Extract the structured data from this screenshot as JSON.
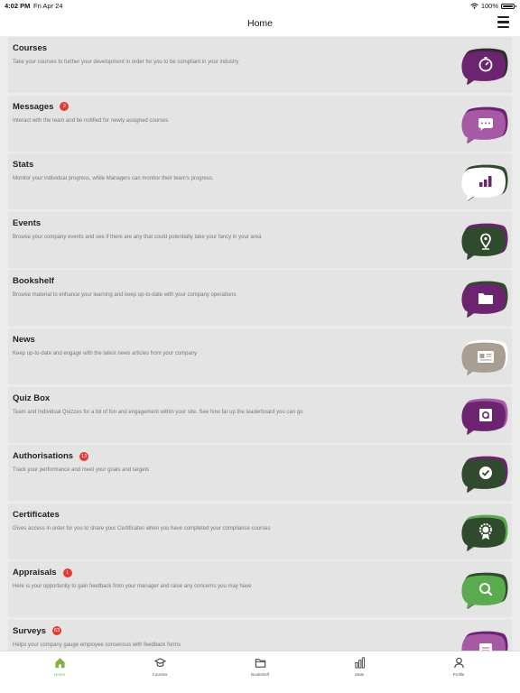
{
  "status": {
    "time": "4:02 PM",
    "date": "Fri Apr 24",
    "battery": "100%"
  },
  "header": {
    "title": "Home"
  },
  "items": [
    {
      "title": "Courses",
      "badge": "",
      "desc": "Take your courses to further your development in order for you to be compliant in your industry",
      "icon": "stopwatch-icon",
      "bubble": "#6d2470",
      "shadow": "#2e2e2e",
      "icon_color": "#ffffff"
    },
    {
      "title": "Messages",
      "badge": "2",
      "desc": "Interact with the team and be notified for newly assigned courses",
      "icon": "chat-icon",
      "bubble": "#a65aa6",
      "shadow": "#6d2470",
      "icon_color": "#ffffff"
    },
    {
      "title": "Stats",
      "badge": "",
      "desc": "Monitor your individual progress, while Managers can monitor their team's progress.",
      "icon": "bar-chart-icon",
      "bubble": "#ffffff",
      "shadow": "#2f4a2c",
      "icon_color": "#6d2470"
    },
    {
      "title": "Events",
      "badge": "",
      "desc": "Browse your company events and see if there are any that could potentially take your fancy in your area",
      "icon": "location-pin-icon",
      "bubble": "#2f4a2c",
      "shadow": "#6d2470",
      "icon_color": "#ffffff"
    },
    {
      "title": "Bookshelf",
      "badge": "",
      "desc": "Browse material to enhance your learning and keep up-to-date with your company operations",
      "icon": "folder-icon",
      "bubble": "#6d2470",
      "shadow": "#2f4a2c",
      "icon_color": "#ffffff"
    },
    {
      "title": "News",
      "badge": "",
      "desc": "Keep up-to-date and engage with the latest news articles from your company",
      "icon": "newspaper-icon",
      "bubble": "#a89e92",
      "shadow": "#ffffff",
      "icon_color": "#ffffff"
    },
    {
      "title": "Quiz Box",
      "badge": "",
      "desc": "Team and Individual Quizzes for a bit of fun and engagement within your site. See how far up the leaderboard you can go",
      "icon": "quiz-icon",
      "bubble": "#6d2470",
      "shadow": "#a65aa6",
      "icon_color": "#ffffff"
    },
    {
      "title": "Authorisations",
      "badge": "13",
      "desc": "Track your performance and meet your goals and targets",
      "icon": "check-circle-icon",
      "bubble": "#2f4a2c",
      "shadow": "#6d2470",
      "icon_color": "#ffffff"
    },
    {
      "title": "Certificates",
      "badge": "",
      "desc": "Gives access in order for you to share your Certificates when you have completed your compliance courses",
      "icon": "award-icon",
      "bubble": "#2f4a2c",
      "shadow": "#5aaa4e",
      "icon_color": "#ffffff"
    },
    {
      "title": "Appraisals",
      "badge": "1",
      "desc": "Here is your opportunity to gain feedback from your manager and raise any concerns you may have",
      "icon": "magnifier-icon",
      "bubble": "#5aaa4e",
      "shadow": "#2f4a2c",
      "icon_color": "#ffffff"
    },
    {
      "title": "Surveys",
      "badge": "63",
      "desc": "Helps your company gauge employee consensus with feedback forms",
      "icon": "survey-icon",
      "bubble": "#a65aa6",
      "shadow": "#6d2470",
      "icon_color": "#ffffff"
    }
  ],
  "tabs": [
    {
      "label": "Home",
      "icon": "home-icon",
      "active": true
    },
    {
      "label": "Courses",
      "icon": "graduation-cap-icon",
      "active": false
    },
    {
      "label": "Bookshelf",
      "icon": "folder-icon",
      "active": false
    },
    {
      "label": "Stats",
      "icon": "bar-chart-icon",
      "active": false
    },
    {
      "label": "Profile",
      "icon": "person-icon",
      "active": false
    }
  ]
}
